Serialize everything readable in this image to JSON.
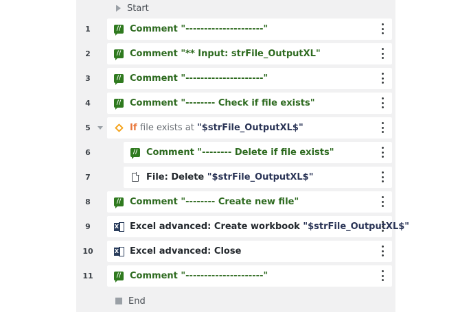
{
  "flow": {
    "start_label": "Start",
    "end_label": "End",
    "steps": [
      {
        "line": "1",
        "icon": "comment-icon",
        "parts": [
          {
            "t": "Comment ",
            "c": "green"
          },
          {
            "t": "\"---------------------\"",
            "c": "green"
          }
        ]
      },
      {
        "line": "2",
        "icon": "comment-icon",
        "parts": [
          {
            "t": "Comment ",
            "c": "green"
          },
          {
            "t": "\"** Input: strFile_OutputXL\"",
            "c": "green"
          }
        ]
      },
      {
        "line": "3",
        "icon": "comment-icon",
        "parts": [
          {
            "t": "Comment ",
            "c": "green"
          },
          {
            "t": "\"---------------------\"",
            "c": "green"
          }
        ]
      },
      {
        "line": "4",
        "icon": "comment-icon",
        "parts": [
          {
            "t": "Comment ",
            "c": "green"
          },
          {
            "t": "\"-------- Check if file exists\"",
            "c": "green"
          }
        ]
      },
      {
        "line": "5",
        "icon": "if-icon",
        "collapsible": true,
        "parts": [
          {
            "t": "If ",
            "c": "orange"
          },
          {
            "t": "file exists at ",
            "c": "gray"
          },
          {
            "t": "\"$strFile_OutputXL$\"",
            "c": "navy"
          }
        ]
      },
      {
        "line": "6",
        "icon": "comment-icon",
        "indent": true,
        "parts": [
          {
            "t": "Comment ",
            "c": "green"
          },
          {
            "t": "\"-------- Delete if file exists\"",
            "c": "green"
          }
        ]
      },
      {
        "line": "7",
        "icon": "file-icon",
        "indent": true,
        "parts": [
          {
            "t": "File: Delete ",
            "c": "dark"
          },
          {
            "t": "\"$strFile_OutputXL$\"",
            "c": "navy"
          }
        ]
      },
      {
        "line": "8",
        "icon": "comment-icon",
        "parts": [
          {
            "t": "Comment ",
            "c": "green"
          },
          {
            "t": "\"-------- Create new file\"",
            "c": "green"
          }
        ]
      },
      {
        "line": "9",
        "icon": "excel-icon",
        "parts": [
          {
            "t": "Excel advanced: Create workbook ",
            "c": "dark"
          },
          {
            "t": "\"$strFile_OutputXL$\"",
            "c": "navy"
          }
        ]
      },
      {
        "line": "10",
        "icon": "excel-icon",
        "parts": [
          {
            "t": "Excel advanced: Close",
            "c": "dark"
          }
        ]
      },
      {
        "line": "11",
        "icon": "comment-icon",
        "parts": [
          {
            "t": "Comment ",
            "c": "green"
          },
          {
            "t": "\"---------------------\"",
            "c": "green"
          }
        ]
      }
    ]
  },
  "colors": {
    "comment": "#2d6a1f",
    "if_keyword": "#e8773b",
    "variable": "#2a3456",
    "panel_bg": "#f1f1f2"
  }
}
